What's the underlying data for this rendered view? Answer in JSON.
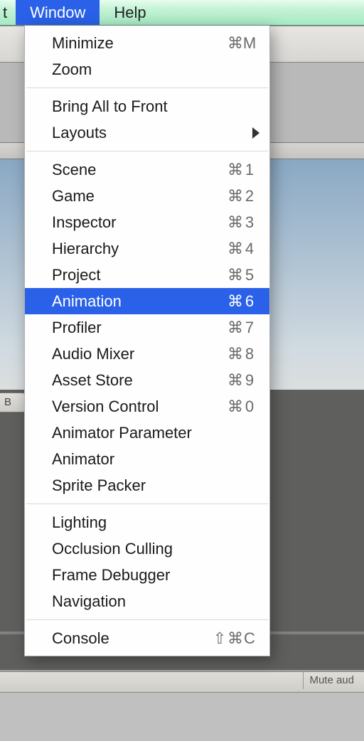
{
  "menubar": {
    "prev_fragment": "t",
    "active": "Window",
    "next": "Help"
  },
  "menu": {
    "groups": [
      [
        {
          "label": "Minimize",
          "shortcut": "⌘M"
        },
        {
          "label": "Zoom"
        }
      ],
      [
        {
          "label": "Bring All to Front"
        },
        {
          "label": "Layouts",
          "submenu": true
        }
      ],
      [
        {
          "label": "Scene",
          "shortcut": "⌘1"
        },
        {
          "label": "Game",
          "shortcut": "⌘2"
        },
        {
          "label": "Inspector",
          "shortcut": "⌘3"
        },
        {
          "label": "Hierarchy",
          "shortcut": "⌘4"
        },
        {
          "label": "Project",
          "shortcut": "⌘5"
        },
        {
          "label": "Animation",
          "shortcut": "⌘6",
          "highlight": true
        },
        {
          "label": "Profiler",
          "shortcut": "⌘7"
        },
        {
          "label": "Audio Mixer",
          "shortcut": "⌘8"
        },
        {
          "label": "Asset Store",
          "shortcut": "⌘9"
        },
        {
          "label": "Version Control",
          "shortcut": "⌘0"
        },
        {
          "label": "Animator Parameter"
        },
        {
          "label": "Animator"
        },
        {
          "label": "Sprite Packer"
        }
      ],
      [
        {
          "label": "Lighting"
        },
        {
          "label": "Occlusion Culling"
        },
        {
          "label": "Frame Debugger"
        },
        {
          "label": "Navigation"
        }
      ],
      [
        {
          "label": "Console",
          "shortcut": "⇧⌘C"
        }
      ]
    ]
  },
  "background": {
    "tag_label": "B",
    "bottom_button_label": "Mute aud"
  }
}
